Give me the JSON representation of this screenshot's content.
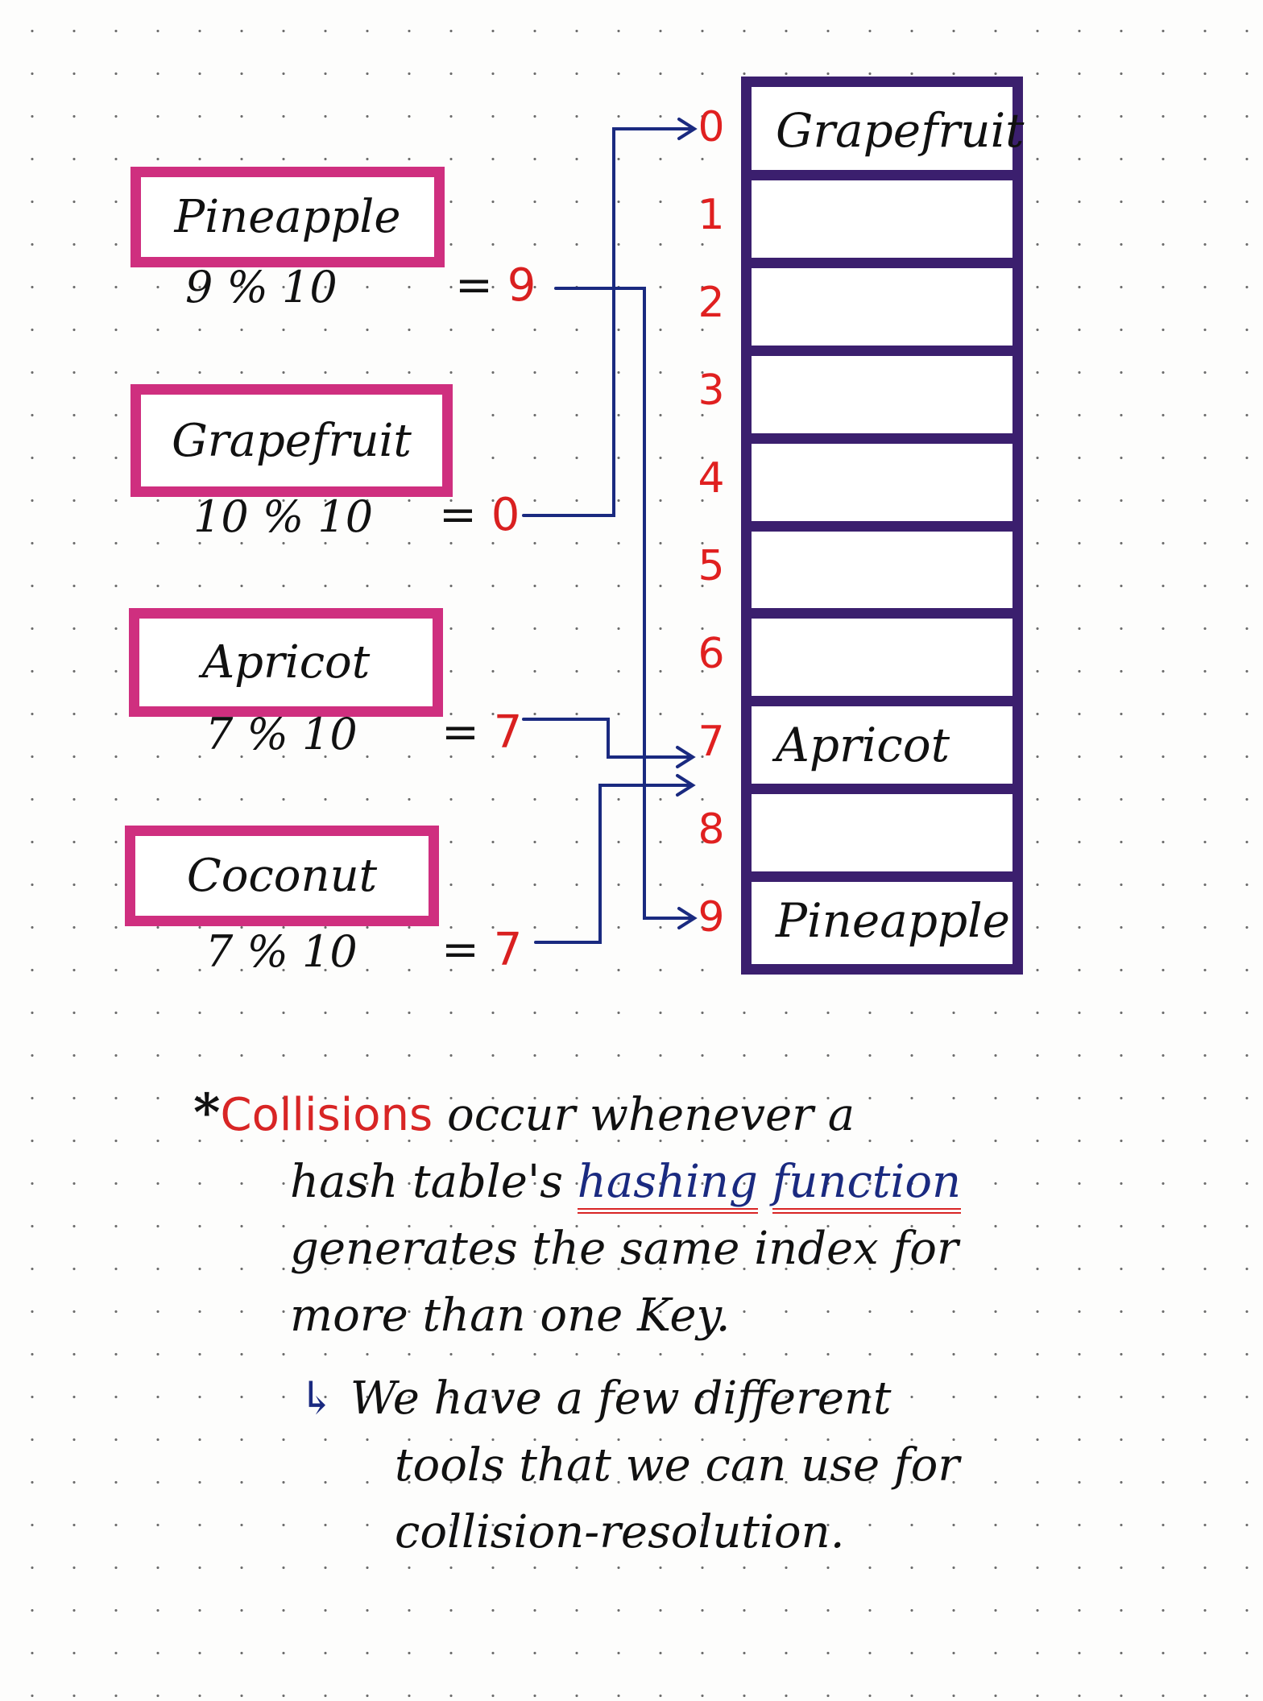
{
  "colors": {
    "key_box_border": "#cf2f7f",
    "table_border": "#3b1f6e",
    "index_text": "#e02020",
    "arrow": "#1a2a80",
    "highlight": "#d82525"
  },
  "keys": [
    {
      "name": "Pineapple",
      "expression": "9 % 10",
      "equals": "=",
      "result": "9"
    },
    {
      "name": "Grapefruit",
      "expression": "10 % 10",
      "equals": "=",
      "result": "0"
    },
    {
      "name": "Apricot",
      "expression": "7 % 10",
      "equals": "=",
      "result": "7"
    },
    {
      "name": "Coconut",
      "expression": "7 % 10",
      "equals": "=",
      "result": "7"
    }
  ],
  "hash_table": {
    "indices": [
      "0",
      "1",
      "2",
      "3",
      "4",
      "5",
      "6",
      "7",
      "8",
      "9"
    ],
    "slots": [
      "Grapefruit",
      "",
      "",
      "",
      "",
      "",
      "",
      "Apricot",
      "",
      "Pineapple"
    ]
  },
  "note": {
    "bullet": "*",
    "highlight_word": "Collisions",
    "line1_rest": " occur whenever a",
    "line2_prefix": "hash table's ",
    "term1": "hashing",
    "term2": "function",
    "line3": "generates the same index for",
    "line4": "more than one Key.",
    "sub_arrow": "↳",
    "sub_line1": "We have a few different",
    "sub_line2": "tools that we can use for",
    "sub_line3": "collision-resolution."
  }
}
